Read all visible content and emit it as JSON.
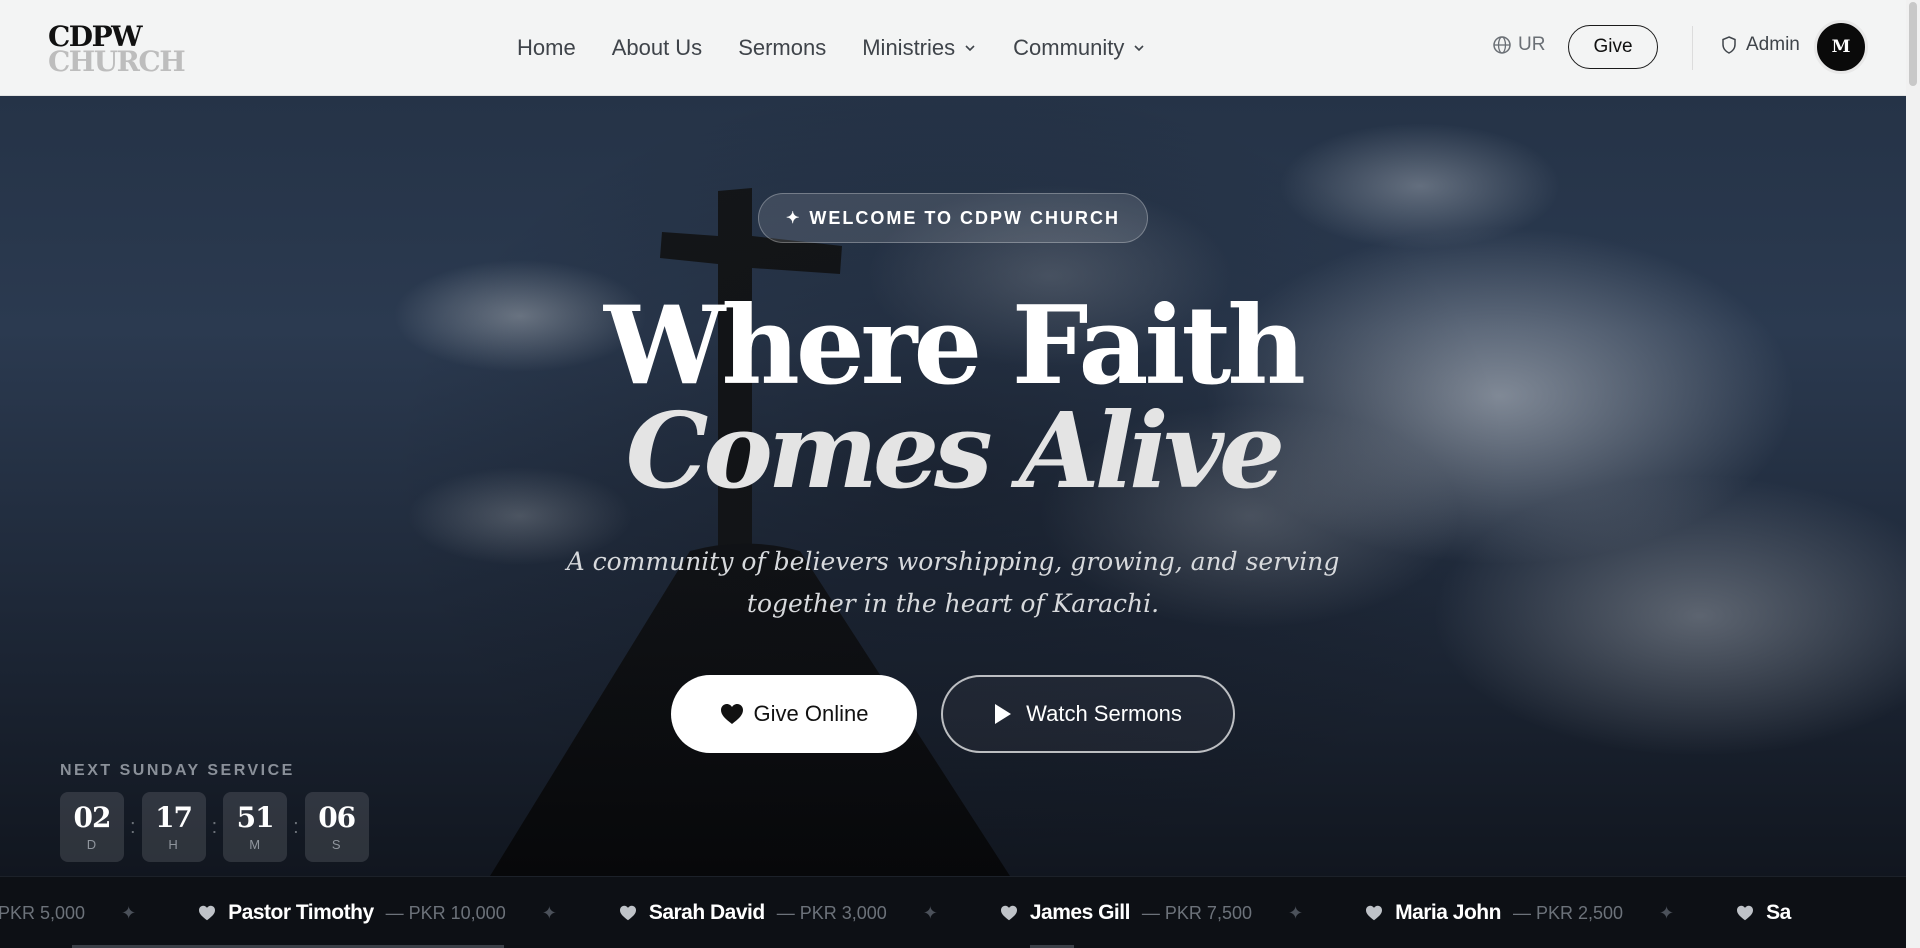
{
  "brand": {
    "line1": "CDPW",
    "line2": "CHURCH"
  },
  "nav": {
    "links": [
      {
        "label": "Home"
      },
      {
        "label": "About Us"
      },
      {
        "label": "Sermons"
      },
      {
        "label": "Ministries",
        "dropdown": true
      },
      {
        "label": "Community",
        "dropdown": true
      }
    ],
    "language": "UR",
    "give_label": "Give",
    "admin_label": "Admin",
    "avatar_initial": "M"
  },
  "hero": {
    "badge": "WELCOME TO CDPW CHURCH",
    "badge_icon": "sparkle-icon",
    "title_line1": "Where Faith",
    "title_line2": "Comes Alive",
    "subtitle": "A community of believers worshipping, growing, and serving together in the heart of Karachi.",
    "give_button": "Give Online",
    "watch_button": "Watch Sermons"
  },
  "countdown": {
    "label": "NEXT SUNDAY SERVICE",
    "days": "02",
    "days_unit": "D",
    "hours": "17",
    "hours_unit": "H",
    "minutes": "51",
    "minutes_unit": "M",
    "seconds": "06",
    "seconds_unit": "S"
  },
  "ticker": {
    "lead_amount": "PKR 5,000",
    "items": [
      {
        "name": "Pastor Timothy",
        "amount": "— PKR 10,000"
      },
      {
        "name": "Sarah David",
        "amount": "— PKR 3,000"
      },
      {
        "name": "James Gill",
        "amount": "— PKR 7,500"
      },
      {
        "name": "Maria John",
        "amount": "— PKR 2,500"
      }
    ],
    "trailing_fragment": "Sa"
  },
  "colors": {
    "accent": "#ffffff",
    "nav_bg": "#f3f4f4",
    "ticker_bg": "#0d1015"
  }
}
